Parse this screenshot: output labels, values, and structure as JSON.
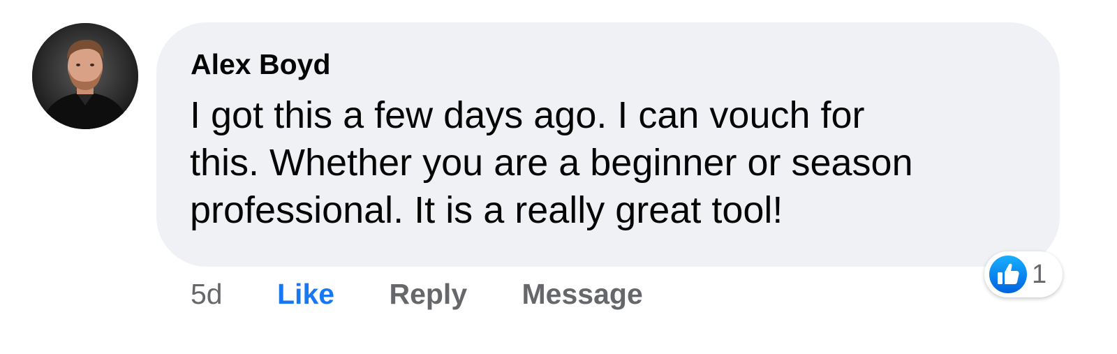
{
  "comment": {
    "author": "Alex Boyd",
    "text_lines": [
      "I got this a few days ago. I can vouch for",
      "this. Whether you are a beginner or season",
      "professional. It is a really great tool!"
    ],
    "timestamp": "5d",
    "actions": {
      "like": "Like",
      "reply": "Reply",
      "message": "Message"
    },
    "reactions": {
      "icon": "thumbs-up-icon",
      "count": "1"
    }
  },
  "colors": {
    "bubble_background": "#f0f1f4",
    "like_blue": "#1877f2",
    "secondary_text": "#65676b",
    "primary_text": "#050505"
  }
}
